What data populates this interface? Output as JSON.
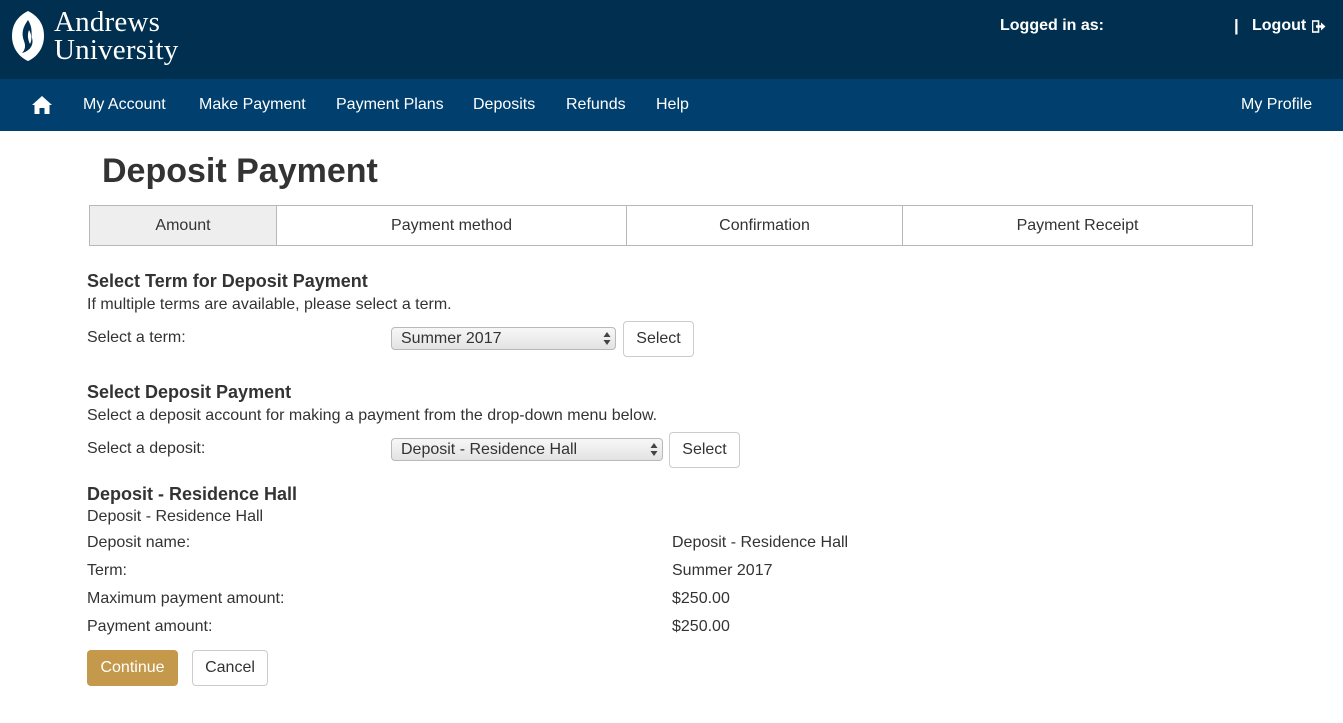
{
  "header": {
    "logo_line1": "Andrews",
    "logo_line2": "University",
    "logged_in_label": "Logged in as:",
    "separator": "|",
    "logout_label": "Logout"
  },
  "nav": {
    "items": [
      "My Account",
      "Make Payment",
      "Payment Plans",
      "Deposits",
      "Refunds",
      "Help"
    ],
    "profile": "My Profile"
  },
  "page": {
    "title": "Deposit Payment"
  },
  "steps": [
    {
      "label": "Amount",
      "active": true
    },
    {
      "label": "Payment method",
      "active": false
    },
    {
      "label": "Confirmation",
      "active": false
    },
    {
      "label": "Payment Receipt",
      "active": false
    }
  ],
  "term_section": {
    "heading": "Select Term for Deposit Payment",
    "description": "If multiple terms are available, please select a term.",
    "label": "Select a term:",
    "selected": "Summer 2017",
    "button": "Select"
  },
  "deposit_section": {
    "heading": "Select Deposit Payment",
    "description": "Select a deposit account for making a payment from the drop-down menu below.",
    "label": "Select a deposit:",
    "selected": "Deposit - Residence Hall",
    "button": "Select"
  },
  "details": {
    "heading": "Deposit - Residence Hall",
    "subheading": "Deposit - Residence Hall",
    "rows": [
      {
        "label": "Deposit name:",
        "value": "Deposit - Residence Hall"
      },
      {
        "label": "Term:",
        "value": "Summer 2017"
      },
      {
        "label": "Maximum payment amount:",
        "value": "$250.00"
      },
      {
        "label": "Payment amount:",
        "value": "$250.00"
      }
    ]
  },
  "actions": {
    "continue": "Continue",
    "cancel": "Cancel"
  },
  "colors": {
    "header_bg": "#002f4f",
    "nav_bg": "#003f6e",
    "primary_button": "#c4994b"
  }
}
